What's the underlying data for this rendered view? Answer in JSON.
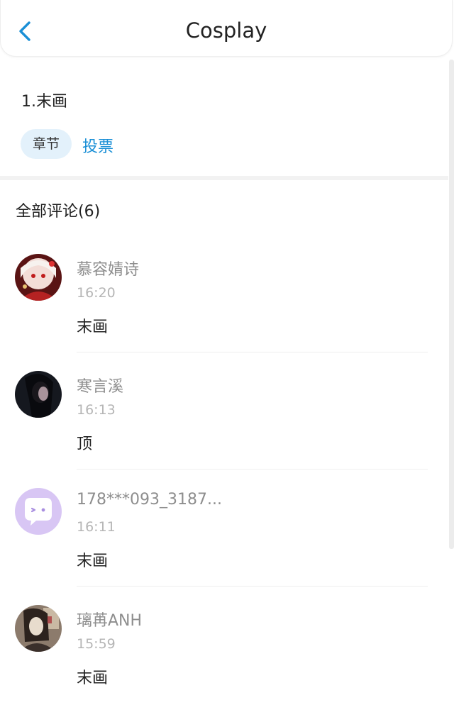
{
  "header": {
    "title": "Cosplay",
    "back_icon": "chevron-left-icon"
  },
  "chapter": {
    "title": "1.末画",
    "tag": "章节",
    "vote_label": "投票"
  },
  "comments": {
    "header": "全部评论(6)",
    "items": [
      {
        "name": "慕容婧诗",
        "time": "16:20",
        "text": "末画",
        "avatar": "anime-girl-red-avatar"
      },
      {
        "name": "寒言溪",
        "time": "16:13",
        "text": "顶",
        "avatar": "dark-hair-girl-avatar"
      },
      {
        "name": "178***093_3187...",
        "time": "16:11",
        "text": "末画",
        "avatar": "chat-bubble-avatar"
      },
      {
        "name": "璃苒ANH",
        "time": "15:59",
        "text": "末画",
        "avatar": "anime-girl-vintage-avatar"
      }
    ]
  },
  "colors": {
    "accent": "#1a8fd6",
    "tag_bg": "#e3f1fb",
    "default_avatar_bg": "#d8c6f4"
  }
}
